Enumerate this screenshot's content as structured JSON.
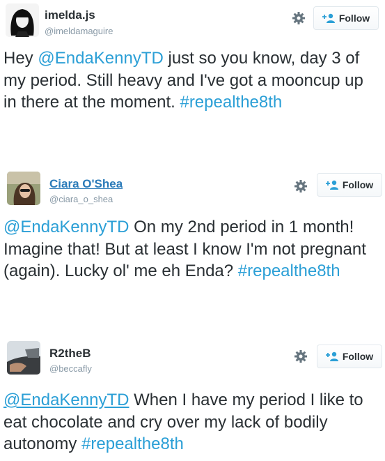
{
  "tweets": [
    {
      "name": "imelda.js",
      "handle": "@imeldamaguire",
      "follow_label": "Follow",
      "text_pre": "Hey ",
      "mention": "@EndaKennyTD",
      "text_mid": " just so you know, day 3 of my period. Still heavy and I've got a mooncup up in there at the moment. ",
      "hashtag": "#repealthe8th"
    },
    {
      "name": "Ciara O'Shea",
      "handle": "@ciara_o_shea",
      "follow_label": "Follow",
      "text_pre": "",
      "mention": "@EndaKennyTD",
      "text_mid": " On my 2nd period in 1 month! Imagine that! But at least I know I'm not pregnant (again). Lucky ol' me eh Enda? ",
      "hashtag": "#repealthe8th"
    },
    {
      "name": "R2theB",
      "handle": "@beccafly",
      "follow_label": "Follow",
      "text_pre": "",
      "mention": "@EndaKennyTD",
      "text_mid": " When I have my period I like to eat chocolate and cry over my lack of bodily autonomy ",
      "hashtag": "#repealthe8th"
    }
  ],
  "icons": {
    "settings": "gear-icon",
    "follow": "add-user-icon"
  },
  "colors": {
    "link": "#2b9fd6",
    "text": "#292f33",
    "handle": "#8899a6"
  }
}
